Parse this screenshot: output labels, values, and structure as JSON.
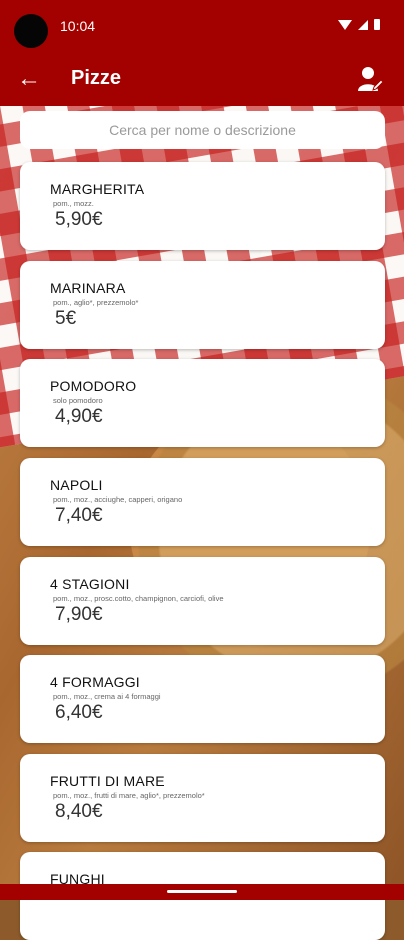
{
  "status_bar": {
    "time": "10:04"
  },
  "app_bar": {
    "title": "Pizze"
  },
  "search": {
    "placeholder": "Cerca per nome o descrizione"
  },
  "pizzas": [
    {
      "name": "MARGHERITA",
      "description": "pom., mozz.",
      "price": "5,90€"
    },
    {
      "name": "MARINARA",
      "description": "pom., aglio*, prezzemolo*",
      "price": "5€"
    },
    {
      "name": "POMODORO",
      "description": "solo pomodoro",
      "price": "4,90€"
    },
    {
      "name": "NAPOLI",
      "description": "pom., moz., acciughe, capperi, origano",
      "price": "7,40€"
    },
    {
      "name": "4 STAGIONI",
      "description": "pom., moz., prosc.cotto, champignon, carciofi, olive",
      "price": "7,90€"
    },
    {
      "name": "4 FORMAGGI",
      "description": "pom., moz., crema ai 4 formaggi",
      "price": "6,40€"
    },
    {
      "name": "FRUTTI DI MARE",
      "description": "pom., moz., frutti di mare, aglio*, prezzemolo*",
      "price": "8,40€"
    },
    {
      "name": "FUNGHI",
      "description": "",
      "price": ""
    }
  ],
  "colors": {
    "primary": "#a30000",
    "card": "#ffffff"
  }
}
